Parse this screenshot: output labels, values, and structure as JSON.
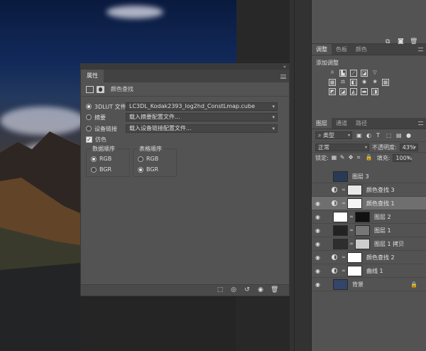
{
  "properties": {
    "tab_title": "属性",
    "subtitle": "颜色查找",
    "rows": [
      {
        "label": "3DLUT 文件",
        "value": "LC3DL_Kodak2393_log2hd_ConstLmap.cube",
        "selected": true
      },
      {
        "label": "摘要",
        "value": "载入摘要配置文件...",
        "selected": false
      },
      {
        "label": "设备链接",
        "value": "载入设备链接配置文件...",
        "selected": false
      }
    ],
    "dither_label": "仿色",
    "data_order": {
      "title": "数据顺序",
      "options": [
        "RGB",
        "BGR"
      ],
      "selected": "RGB"
    },
    "table_order": {
      "title": "表格顺序",
      "options": [
        "RGB",
        "BGR"
      ],
      "selected": "BGR"
    }
  },
  "adjustments": {
    "tabs": [
      "调整",
      "色板",
      "颜色"
    ],
    "title": "添加调整"
  },
  "layers_panel": {
    "tabs": [
      "图层",
      "通道",
      "路径"
    ],
    "filter_kind": "类型",
    "blend_mode": "正常",
    "opacity_label": "不透明度:",
    "opacity_value": "43%",
    "lock_label": "锁定:",
    "fill_label": "填充:",
    "fill_value": "100%",
    "layers": [
      {
        "name": "图层 3",
        "visible": false,
        "kind": "image",
        "thumb": "#2a3a55",
        "mask": null,
        "selected": false
      },
      {
        "name": "颜色查找 3",
        "visible": false,
        "kind": "adjustment",
        "thumb": null,
        "mask": "#e8e8e8",
        "selected": false
      },
      {
        "name": "颜色查找 1",
        "visible": true,
        "kind": "adjustment",
        "thumb": null,
        "mask": "#f4f4f4",
        "selected": true
      },
      {
        "name": "图层 2",
        "visible": true,
        "kind": "image",
        "thumb": "#ffffff",
        "mask": "#111111",
        "selected": false
      },
      {
        "name": "图层 1",
        "visible": true,
        "kind": "image",
        "thumb": "#222222",
        "mask": "#777777",
        "selected": false
      },
      {
        "name": "图层 1 拷贝",
        "visible": true,
        "kind": "image",
        "thumb": "#2e2e2e",
        "mask": "#cccccc",
        "selected": false
      },
      {
        "name": "颜色查找 2",
        "visible": true,
        "kind": "adjustment",
        "thumb": null,
        "mask": "#ffffff",
        "selected": false
      },
      {
        "name": "曲线 1",
        "visible": true,
        "kind": "adjustment",
        "thumb": null,
        "mask": "#ffffff",
        "selected": false
      },
      {
        "name": "背景",
        "visible": true,
        "kind": "image",
        "thumb": "#33456a",
        "mask": null,
        "selected": false,
        "locked": true
      }
    ]
  }
}
